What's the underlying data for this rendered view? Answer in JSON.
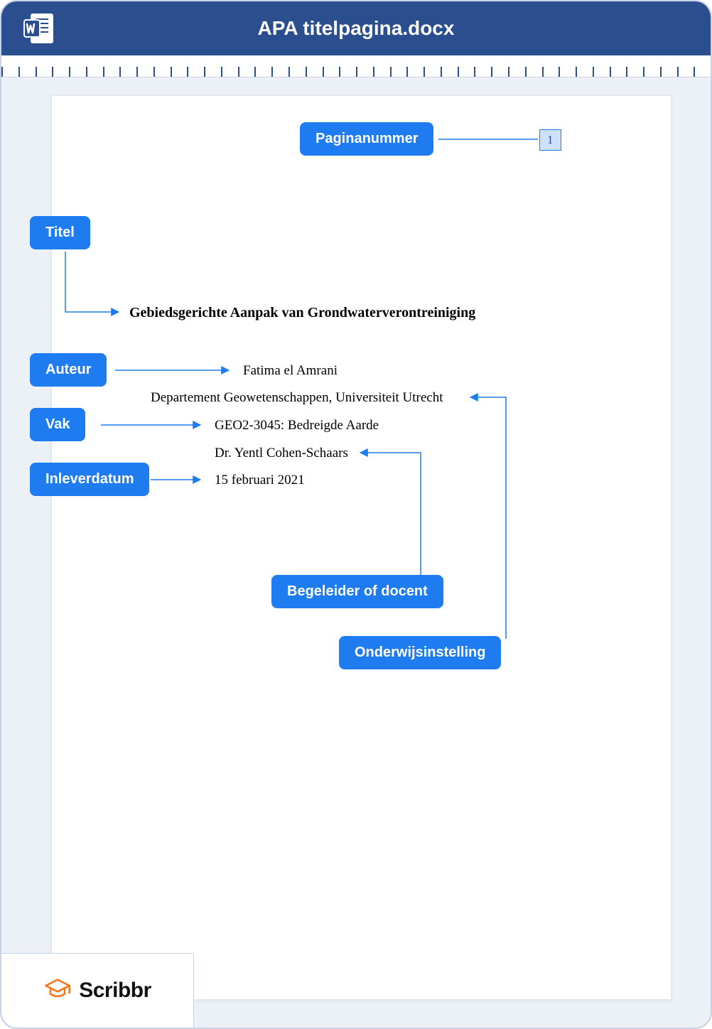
{
  "app": {
    "doc_title": "APA titelpagina.docx"
  },
  "tags": {
    "page_number": "Paginanummer",
    "title": "Titel",
    "author": "Auteur",
    "course": "Vak",
    "due_date": "Inleverdatum",
    "supervisor": "Begeleider of docent",
    "institution": "Onderwijsinstelling"
  },
  "document": {
    "page_number": "1",
    "title": "Gebiedsgerichte Aanpak van Grondwaterverontreiniging",
    "author": "Fatima el Amrani",
    "institution": "Departement Geowetenschappen, Universiteit Utrecht",
    "course": "GEO2-3045: Bedreigde Aarde",
    "supervisor": "Dr. Yentl Cohen-Schaars",
    "due_date": "15 februari 2021"
  },
  "brand": {
    "name": "Scribbr"
  },
  "colors": {
    "accent": "#1F7CF0",
    "header": "#2B4E8F",
    "highlight": "#CEE1FC",
    "brand_orange": "#F97316"
  }
}
